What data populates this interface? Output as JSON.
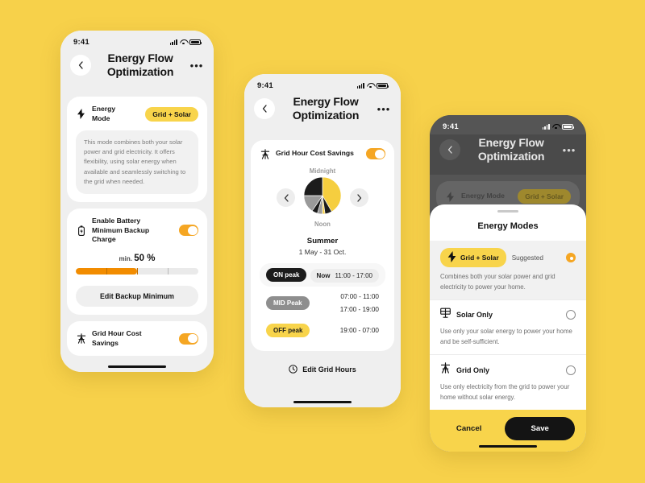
{
  "background_color": "#F7D14A",
  "accent": {
    "yellow": "#F8D44B",
    "orange": "#F5A623",
    "dark": "#1C1C1C",
    "gray": "#8E8E8E"
  },
  "status_bar": {
    "time": "9:41"
  },
  "phone1": {
    "header": {
      "back_icon": "chevron-left-icon",
      "title": "Energy Flow Optimization",
      "more_icon": "ellipsis-icon"
    },
    "energy_mode": {
      "icon": "bolt-icon",
      "label": "Energy Mode",
      "value": "Grid + Solar",
      "description": "This mode combines both your solar power and grid electricity. It offers flexibility, using solar energy when available and seamlessly switching to the grid when needed."
    },
    "battery_backup": {
      "icon": "battery-icon",
      "label": "Enable Battery Minimum Backup Charge",
      "toggle_on": true,
      "min_prefix": "min.",
      "min_value": "50 %",
      "percent": 50,
      "edit_label": "Edit Backup Minimum"
    },
    "grid_savings": {
      "icon": "pylon-icon",
      "label": "Grid Hour Cost Savings",
      "toggle_on": true
    }
  },
  "phone2": {
    "header": {
      "back_icon": "chevron-left-icon",
      "title": "Energy Flow Optimization",
      "more_icon": "ellipsis-icon"
    },
    "grid_savings": {
      "icon": "pylon-icon",
      "label": "Grid Hour Cost Savings",
      "toggle_on": true
    },
    "clock_chart": {
      "top_label": "Midnight",
      "bottom_label": "Noon",
      "prev_icon": "chevron-left-icon",
      "next_icon": "chevron-right-icon"
    },
    "season": {
      "name": "Summer",
      "range": "1 May - 31 Oct."
    },
    "bands": [
      {
        "tag": "ON peak",
        "style": "on",
        "now_label": "Now",
        "times": [
          "11:00 - 17:00"
        ],
        "highlight": true
      },
      {
        "tag": "MID Peak",
        "style": "mid",
        "now_label": "",
        "times": [
          "07:00 - 11:00",
          "17:00 - 19:00"
        ],
        "highlight": false
      },
      {
        "tag": "OFF peak",
        "style": "off",
        "now_label": "",
        "times": [
          "19:00 - 07:00"
        ],
        "highlight": false
      }
    ],
    "edit_button": {
      "icon": "clock-icon",
      "label": "Edit Grid Hours"
    }
  },
  "phone3": {
    "header": {
      "back_icon": "chevron-left-icon",
      "title": "Energy Flow Optimization",
      "more_icon": "ellipsis-icon"
    },
    "behind": {
      "label": "Energy Mode",
      "value": "Grid + Solar"
    },
    "sheet": {
      "title": "Energy Modes",
      "options": [
        {
          "icon": "bolt-icon",
          "name": "Grid + Solar",
          "badge": "Suggested",
          "selected": true,
          "description": "Combines both your solar power and grid electricity to power your home."
        },
        {
          "icon": "solar-panel-icon",
          "name": "Solar Only",
          "badge": "",
          "selected": false,
          "description": "Use only your solar energy to power your home and be self-sufficient."
        },
        {
          "icon": "pylon-icon",
          "name": "Grid Only",
          "badge": "",
          "selected": false,
          "description": "Use only electricity from the grid to power your home without solar energy."
        }
      ],
      "cancel_label": "Cancel",
      "save_label": "Save"
    }
  },
  "chart_data": {
    "type": "pie",
    "title": "Grid hour cost distribution over 24 hours",
    "categories": [
      "OFF peak",
      "MID Peak",
      "ON peak"
    ],
    "values": [
      12,
      6,
      6
    ],
    "colors": [
      "#F5CE3F",
      "#9A9A9A",
      "#1C1C1C"
    ],
    "unit": "hours",
    "annotations": [
      "Midnight",
      "Noon"
    ],
    "legend": "none"
  }
}
